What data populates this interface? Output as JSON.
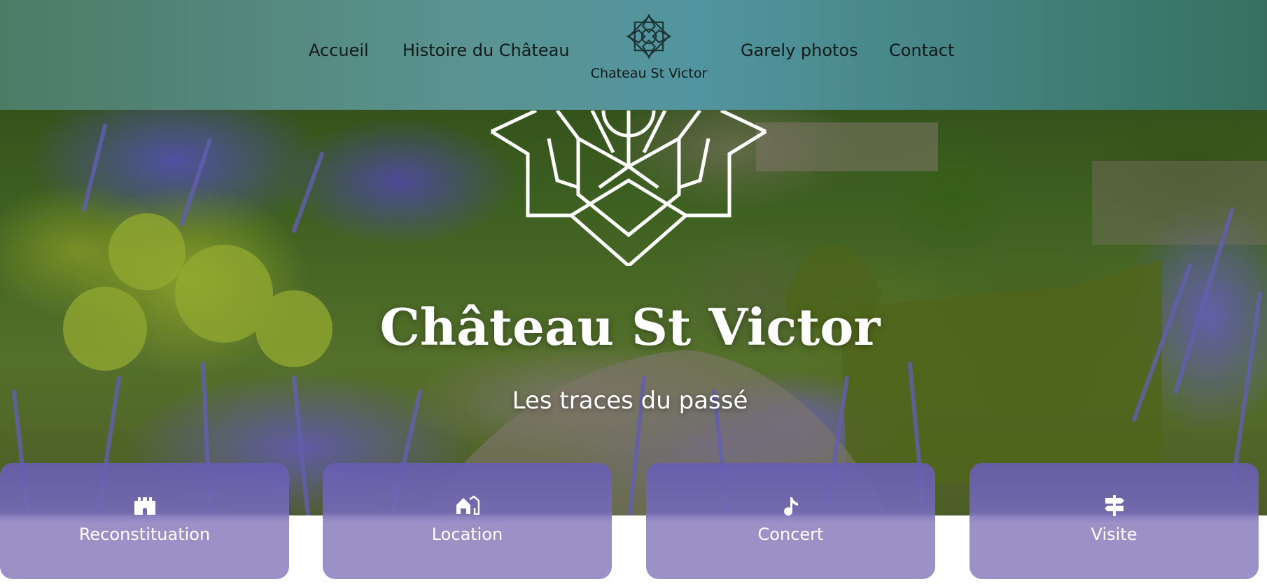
{
  "nav": {
    "links_left": [
      {
        "label": "Accueil"
      },
      {
        "label": "Histoire du Château"
      }
    ],
    "links_right": [
      {
        "label": "Garely photos"
      },
      {
        "label": "Contact"
      }
    ],
    "brand": {
      "name": "Chateau St Victor",
      "icon": "chateau-emblem-icon"
    }
  },
  "hero": {
    "emblem_icon": "chateau-emblem-icon",
    "title": "Château St Victor",
    "subtitle": "Les traces du passé"
  },
  "cards": [
    {
      "label": "Reconstituation",
      "icon": "castle-icon"
    },
    {
      "label": "Location",
      "icon": "houses-icon"
    },
    {
      "label": "Concert",
      "icon": "music-note-icon"
    },
    {
      "label": "Visite",
      "icon": "signpost-icon"
    }
  ],
  "colors": {
    "card_purple": "#9c91c6",
    "card_purple_dark": "#685cb2",
    "text_light": "#ffffff",
    "nav_text": "#131a1a"
  }
}
